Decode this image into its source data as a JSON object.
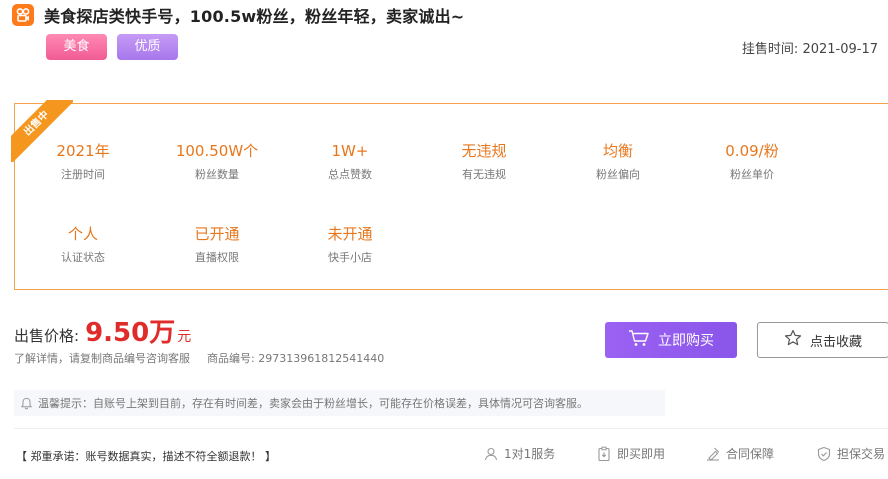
{
  "header": {
    "title": "美食探店类快手号，100.5w粉丝，粉丝年轻，卖家诚出~",
    "logo_icon": "kuaishou-logo-icon",
    "tags": [
      "美食",
      "优质"
    ],
    "list_time_label": "挂售时间:",
    "list_time_value": "2021-09-17"
  },
  "info_box": {
    "ribbon_text": "出售中",
    "stats": [
      {
        "value": "2021年",
        "label": "注册时间"
      },
      {
        "value": "100.50W个",
        "label": "粉丝数量"
      },
      {
        "value": "1W+",
        "label": "总点赞数"
      },
      {
        "value": "无违规",
        "label": "有无违规"
      },
      {
        "value": "均衡",
        "label": "粉丝偏向"
      },
      {
        "value": "0.09/粉",
        "label": "粉丝单价"
      },
      {
        "value": "个人",
        "label": "认证状态"
      },
      {
        "value": "已开通",
        "label": "直播权限"
      },
      {
        "value": "未开通",
        "label": "快手小店"
      }
    ]
  },
  "price": {
    "label": "出售价格:",
    "value": "9.50万",
    "unit": "元"
  },
  "details": {
    "consult_text": "了解详情，请复制商品编号咨询客服",
    "item_no_label": "商品编号:",
    "item_no_value": "297313961812541440"
  },
  "actions": {
    "buy_label": "立即购买",
    "favorite_label": "点击收藏"
  },
  "notice": {
    "text": "温馨提示：自账号上架到目前，存在有时间差，卖家会由于粉丝增长，可能存在价格误差，具体情况可咨询客服。"
  },
  "promise": {
    "text": "【 郑重承诺：账号数据真实，描述不符全额退款！ 】"
  },
  "services": [
    "1对1服务",
    "即买即用",
    "合同保障",
    "担保交易"
  ],
  "colors": {
    "accent_orange": "#e8771c",
    "price_red": "#e02b2b",
    "buy_purple": "#9b62f2",
    "tag_pink": "#f15b95",
    "tag_purple": "#a777ec"
  }
}
